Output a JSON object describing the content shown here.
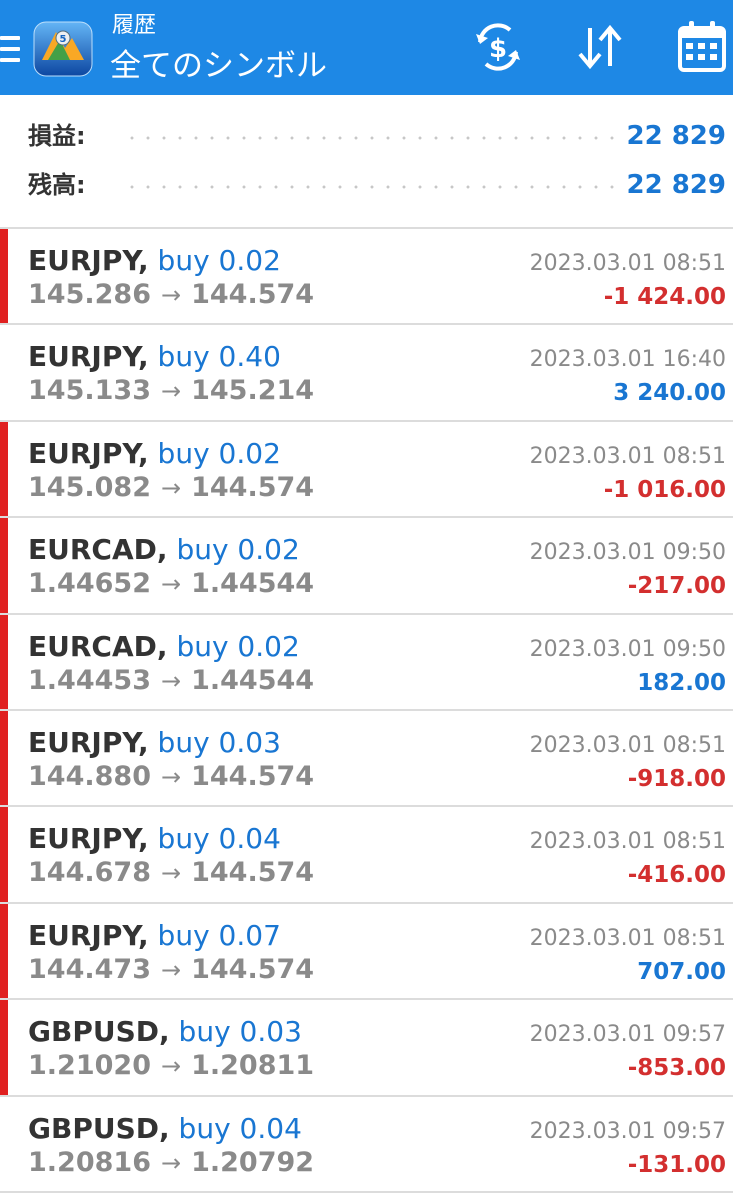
{
  "header": {
    "subtitle": "履歴",
    "title": "全てのシンボル",
    "colors": {
      "background": "#1e88e5",
      "text": "#ffffff"
    },
    "icons": [
      "menu-icon",
      "app-logo",
      "currency-exchange-icon",
      "sort-icon",
      "calendar-icon"
    ]
  },
  "summary": {
    "profit_label": "損益:",
    "profit_value": "22 829",
    "balance_label": "残高:",
    "balance_value": "22 829"
  },
  "colors": {
    "loss": "#d32f2f",
    "gain": "#1976d2",
    "loss_marker": "#e02020"
  },
  "deals": [
    {
      "symbol": "EURJPY,",
      "type": "buy 0.02",
      "open_price": "145.286",
      "close_price": "144.574",
      "time": "2023.03.01 08:51",
      "profit": "-1 424.00",
      "loss": true
    },
    {
      "symbol": "EURJPY,",
      "type": "buy 0.40",
      "open_price": "145.133",
      "close_price": "145.214",
      "time": "2023.03.01 16:40",
      "profit": "3 240.00",
      "loss": false
    },
    {
      "symbol": "EURJPY,",
      "type": "buy 0.02",
      "open_price": "145.082",
      "close_price": "144.574",
      "time": "2023.03.01 08:51",
      "profit": "-1 016.00",
      "loss": true
    },
    {
      "symbol": "EURCAD,",
      "type": "buy 0.02",
      "open_price": "1.44652",
      "close_price": "1.44544",
      "time": "2023.03.01 09:50",
      "profit": "-217.00",
      "loss": true
    },
    {
      "symbol": "EURCAD,",
      "type": "buy 0.02",
      "open_price": "1.44453",
      "close_price": "1.44544",
      "time": "2023.03.01 09:50",
      "profit": "182.00",
      "loss": true
    },
    {
      "symbol": "EURJPY,",
      "type": "buy 0.03",
      "open_price": "144.880",
      "close_price": "144.574",
      "time": "2023.03.01 08:51",
      "profit": "-918.00",
      "loss": true
    },
    {
      "symbol": "EURJPY,",
      "type": "buy 0.04",
      "open_price": "144.678",
      "close_price": "144.574",
      "time": "2023.03.01 08:51",
      "profit": "-416.00",
      "loss": true
    },
    {
      "symbol": "EURJPY,",
      "type": "buy 0.07",
      "open_price": "144.473",
      "close_price": "144.574",
      "time": "2023.03.01 08:51",
      "profit": "707.00",
      "loss": true
    },
    {
      "symbol": "GBPUSD,",
      "type": "buy 0.03",
      "open_price": "1.21020",
      "close_price": "1.20811",
      "time": "2023.03.01 09:57",
      "profit": "-853.00",
      "loss": true
    },
    {
      "symbol": "GBPUSD,",
      "type": "buy 0.04",
      "open_price": "1.20816",
      "close_price": "1.20792",
      "time": "2023.03.01 09:57",
      "profit": "-131.00",
      "loss": false
    }
  ],
  "arrow_glyph": "→"
}
